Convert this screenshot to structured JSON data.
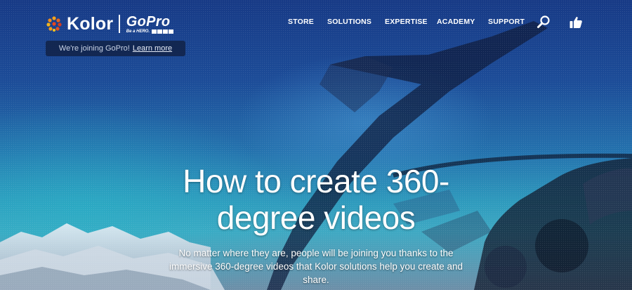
{
  "brand": {
    "kolor": "Kolor",
    "gopro": "GoPro",
    "gopro_tagline": "Be a HERO."
  },
  "nav": {
    "items": [
      "STORE",
      "SOLUTIONS",
      "EXPERTISE",
      "ACADEMY",
      "SUPPORT"
    ],
    "search_icon": "search-icon",
    "like_icon": "thumbs-up-icon"
  },
  "banner": {
    "text": "We're joining GoPro!",
    "link": "Learn more"
  },
  "hero": {
    "title": "How to create 360-degree videos",
    "subtitle": "No matter where they are, people will be joining you thanks to the immersive 360-degree videos that Kolor solutions help you create and share."
  },
  "colors": {
    "sky_top": "#173a86",
    "sky_bottom": "#3fa9c3",
    "banner_bg": "#122246",
    "text": "#ffffff"
  }
}
